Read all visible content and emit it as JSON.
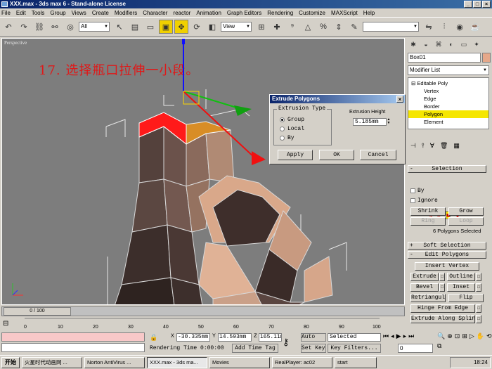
{
  "window": {
    "title": "XXX.max - 3ds max 6 - Stand-alone License",
    "buttons": [
      "_",
      "□",
      "×"
    ]
  },
  "menu": [
    "File",
    "Edit",
    "Tools",
    "Group",
    "Views",
    "Create",
    "Modifiers",
    "Character",
    "reactor",
    "Animation",
    "Graph Editors",
    "Rendering",
    "Customize",
    "MAXScript",
    "Help"
  ],
  "toolbar": {
    "filter_select": "All",
    "coord_select": "View"
  },
  "viewport": {
    "label": "Perspective",
    "annotation": "17. 选择瓶口拉伸一小段。"
  },
  "dialog": {
    "title": "Extrude Polygons",
    "close": "×",
    "group_label": "Extrusion Type",
    "options": [
      "Group",
      "Local",
      "By"
    ],
    "selected": "Group",
    "height_label": "Extrusion Height",
    "height_value": "5.185mm",
    "apply": "Apply",
    "ok": "OK",
    "cancel": "Cancel"
  },
  "command_panel": {
    "object_name": "Box01",
    "modifier_list": "Modifier List",
    "stack": [
      "Editable Poly",
      "Vertex",
      "Edge",
      "Border",
      "Polygon",
      "Element"
    ],
    "stack_selected": "Polygon",
    "selection_header": "Selection",
    "by_label": "By",
    "ignore_label": "Ignore",
    "shrink": "Shrink",
    "grow": "Grow",
    "ring": "Ring",
    "loop": "Loop",
    "count_text": "6 Polygons Selected",
    "soft_header": "Soft Selection",
    "edit_header": "Edit Polygons",
    "insert_vertex": "Insert Vertex",
    "extrude": "Extrude",
    "outline": "Outline",
    "bevel": "Bevel",
    "inset": "Inset",
    "retriangulate": "Retriangulate",
    "flip": "Flip",
    "hinge": "Hinge From Edge",
    "extrude_spline": "Extrude Along Spline"
  },
  "timeline": {
    "slider": "0 / 100",
    "ticks": [
      "0",
      "10",
      "20",
      "30",
      "40",
      "50",
      "60",
      "70",
      "80",
      "90",
      "100"
    ]
  },
  "status": {
    "x_label": "X",
    "x": "-30.335mm",
    "y_label": "Y",
    "y": "14.593mm",
    "z_label": "Z",
    "z": "165.11mm",
    "render_time": "Rendering Time  0:00:00",
    "add_time_tag": "Add Time Tag",
    "auto_key": "Auto Key",
    "selected": "Selected",
    "set_key": "Set Key",
    "key_filters": "Key Filters...",
    "frame": "0"
  },
  "taskbar": {
    "start": "开始",
    "tasks": [
      "火星时代动画网 ...",
      "Norton AntiVirus ...",
      "XXX.max - 3ds ma...",
      "Movies",
      "RealPlayer: ac02",
      "start"
    ],
    "active": "XXX.max - 3ds ma...",
    "clock": "18:24"
  },
  "colors": {
    "selected_face": "#ff1a1a",
    "highlight": "#f5e600",
    "title_blue": "#0a246a",
    "annotation": "#e01818"
  }
}
